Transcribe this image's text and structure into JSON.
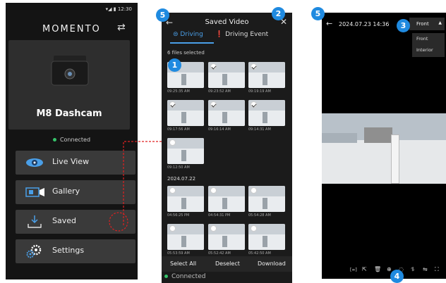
{
  "panel1": {
    "status_time": "12:30",
    "brand": "MOMENTO",
    "device_name": "M8 Dashcam",
    "connection": "Connected",
    "menu": [
      {
        "label": "Live View"
      },
      {
        "label": "Gallery"
      },
      {
        "label": "Saved"
      },
      {
        "label": "Settings"
      }
    ]
  },
  "panel2": {
    "title": "Saved Video",
    "tabs": [
      {
        "label": "Driving"
      },
      {
        "label": "Driving Event"
      }
    ],
    "selected_info": "6 files selected",
    "thumbs_top": [
      {
        "time": "09:25:35 AM"
      },
      {
        "time": "09:23:52 AM"
      },
      {
        "time": "09:19:19 AM"
      },
      {
        "time": "09:17:56 AM"
      },
      {
        "time": "09:16:14 AM"
      },
      {
        "time": "09:14:31 AM"
      },
      {
        "time": "09:12:50 AM"
      }
    ],
    "date_header": "2024.07.22",
    "thumbs_bottom": [
      {
        "time": "04:56:25 PM"
      },
      {
        "time": "04:54:31 PM"
      },
      {
        "time": "05:54:28 AM"
      },
      {
        "time": "05:53:59 AM"
      },
      {
        "time": "05:52:42 AM"
      },
      {
        "time": "05:42:50 AM"
      }
    ],
    "actions": [
      "Select All",
      "Deselect",
      "Download"
    ],
    "footer": "Connected"
  },
  "panel3": {
    "datetime": "2024.07.23 14:36",
    "camera_select": "Front",
    "camera_options": [
      "Front",
      "Interior"
    ]
  },
  "callouts": [
    "1",
    "2",
    "3",
    "4",
    "5",
    "5"
  ],
  "colors": {
    "callout": "#1f8ae0",
    "accent": "#4a9fe8",
    "status_green": "#36c36a",
    "arrow_red": "#e02020"
  }
}
